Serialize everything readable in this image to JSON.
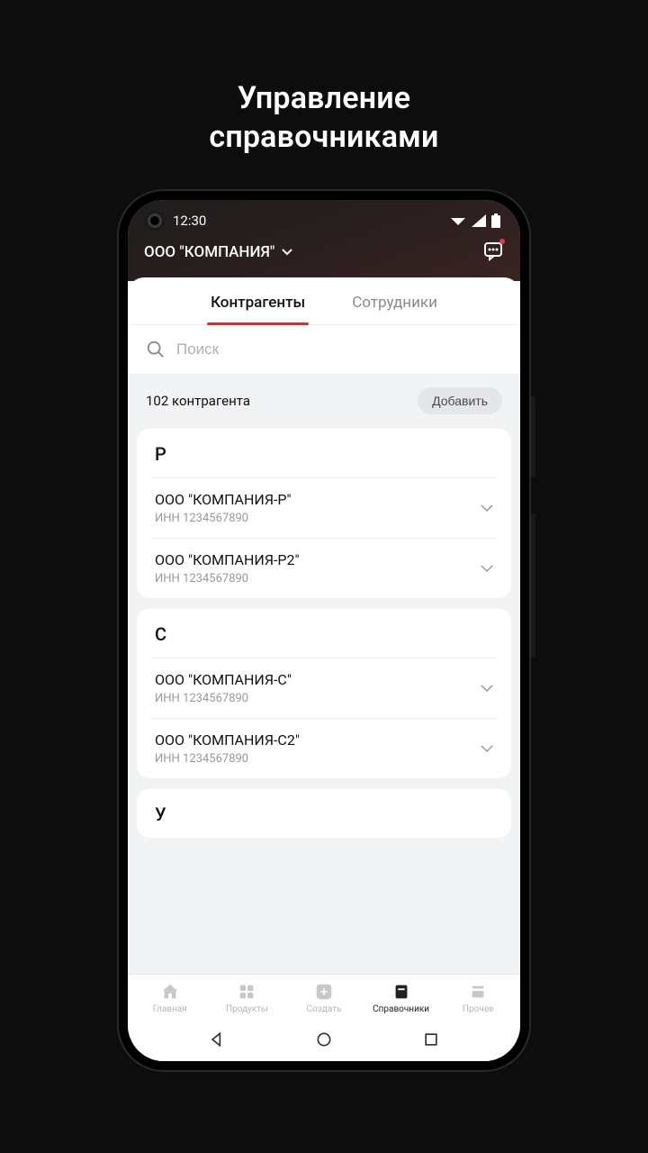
{
  "page_title_line1": "Управление",
  "page_title_line2": "справочниками",
  "status": {
    "time": "12:30"
  },
  "header": {
    "org_name": "ООО \"КОМПАНИЯ\""
  },
  "tabs": {
    "active": "Контрагенты",
    "inactive": "Сотрудники"
  },
  "search": {
    "placeholder": "Поиск"
  },
  "count_row": {
    "text": "102 контрагента",
    "add_label": "Добавить"
  },
  "groups": [
    {
      "letter": "Р",
      "items": [
        {
          "name": "ООО \"КОМПАНИЯ-Р\"",
          "inn": "ИНН 1234567890"
        },
        {
          "name": "ООО \"КОМПАНИЯ-Р2\"",
          "inn": "ИНН 1234567890"
        }
      ]
    },
    {
      "letter": "С",
      "items": [
        {
          "name": "ООО \"КОМПАНИЯ-С\"",
          "inn": "ИНН 1234567890"
        },
        {
          "name": "ООО \"КОМПАНИЯ-С2\"",
          "inn": "ИНН 1234567890"
        }
      ]
    },
    {
      "letter": "У",
      "items": []
    }
  ],
  "tabbar": {
    "home": "Главная",
    "products": "Продукты",
    "create": "Создать",
    "refs": "Справочники",
    "more": "Прочее"
  }
}
